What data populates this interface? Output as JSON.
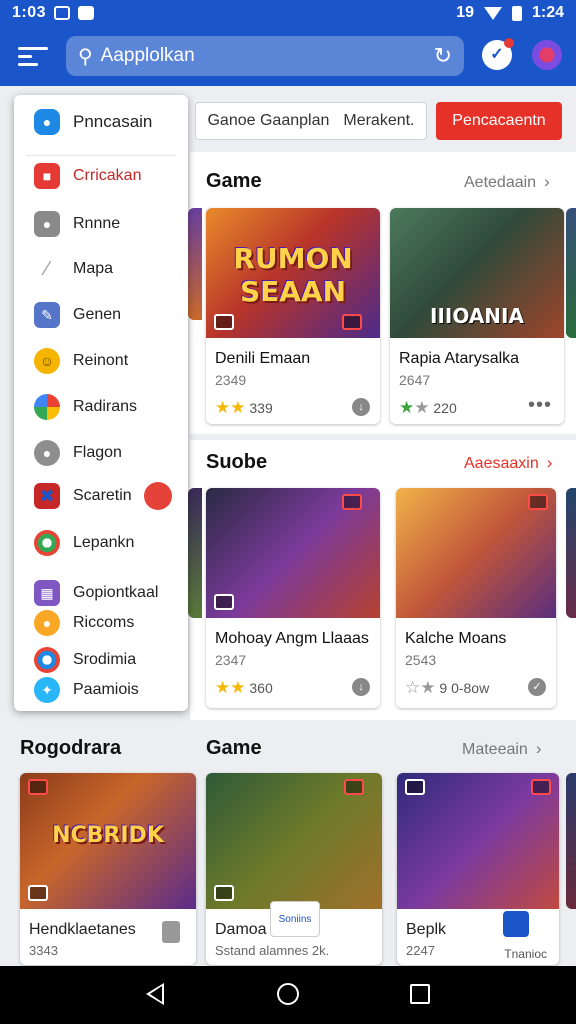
{
  "status_bar": {
    "time": "1:03",
    "right_text": "19",
    "clock_right": "1:24"
  },
  "app_bar": {
    "search_placeholder": "Aapplolkan",
    "icons": [
      "menu-icon",
      "search-icon",
      "refresh-icon",
      "profile-badge-icon",
      "flower-icon"
    ]
  },
  "filters": {
    "search_chip_left": "Ganoe Gaanplan",
    "search_chip_right": "Merakent.",
    "red_button": "Pencacaentn"
  },
  "drawer": {
    "items": [
      {
        "label": "Pnncasain",
        "icon": "puzzle-icon",
        "color": "#1e88e5"
      },
      {
        "label": "Crricakan",
        "icon": "red-square-icon",
        "color": "#e53935"
      },
      {
        "label": "Rnnne",
        "icon": "lock-icon",
        "color": "#8a8a8a"
      },
      {
        "label": "Mapa",
        "icon": "paperclip-icon",
        "color": "#9e9e9e"
      },
      {
        "label": "Genen",
        "icon": "pen-icon",
        "color": "#5576c8"
      },
      {
        "label": "Reinont",
        "icon": "smiley-icon",
        "color": "#f4b400"
      },
      {
        "label": "Radirans",
        "icon": "color-wheel-icon",
        "color": "#4285f4"
      },
      {
        "label": "Flagon",
        "icon": "controller-icon",
        "color": "#8e8e8e"
      },
      {
        "label": "Scaretin",
        "icon": "shuriken-icon",
        "color": "#c62828"
      },
      {
        "label": "Lepankn",
        "icon": "chrome-icon",
        "color": "#34a853"
      },
      {
        "label": "Gopiontkaal",
        "icon": "grid-icon",
        "color": "#7e57c2"
      },
      {
        "label": "Riccoms",
        "icon": "coin-icon",
        "color": "#f9a825"
      },
      {
        "label": "Srodimia",
        "icon": "chrome-icon",
        "color": "#1e88e5"
      },
      {
        "label": "Paamiois",
        "icon": "bluebird-icon",
        "color": "#29b6f6"
      }
    ]
  },
  "sections": [
    {
      "title": "Game",
      "more": "Aetedaain",
      "cards": [
        {
          "art_title": "RUMON SEAAN",
          "name": "Denili Emaan",
          "count": "2349",
          "rating": "339",
          "action": "download-icon",
          "colors": [
            "#d9532a",
            "#7b2fa8"
          ]
        },
        {
          "art_title": "IIIOANIA",
          "name": "Rapia Atarysalka",
          "count": "2647",
          "rating": "220",
          "action": "more-icon",
          "colors": [
            "#3a5f3a",
            "#8f3d24"
          ]
        }
      ]
    },
    {
      "title": "Suobe",
      "more": "Aaesaaxin",
      "cards": [
        {
          "art_title": "",
          "name": "Mohoay Angm Llaaas",
          "count": "2347",
          "rating": "360",
          "action": "download-icon",
          "colors": [
            "#2f2f48",
            "#8a2b86"
          ]
        },
        {
          "art_title": "",
          "name": "Kalche Moans",
          "count": "2543",
          "rating": "9 0-8ow",
          "action": "check-icon",
          "colors": [
            "#e08b2c",
            "#5a2d7a"
          ]
        }
      ]
    }
  ],
  "bottom": {
    "left_title": "Rogodrara",
    "title": "Game",
    "more": "Mateeain",
    "cards": [
      {
        "art_title": "NCBRIDK",
        "name": "Hendklaetanes",
        "count": "3343",
        "colors": [
          "#7a3b16",
          "#6b2c8a"
        ]
      },
      {
        "art_title": "",
        "name": "Damoa",
        "count": "Sstand alamnes 2k.",
        "badge": "Soniins",
        "colors": [
          "#2d5a2d",
          "#a27020"
        ]
      },
      {
        "art_title": "",
        "name": "Beplk",
        "count": "2247",
        "badge": "Tnanioc",
        "colors": [
          "#3a2c7a",
          "#b13b52"
        ]
      }
    ]
  }
}
